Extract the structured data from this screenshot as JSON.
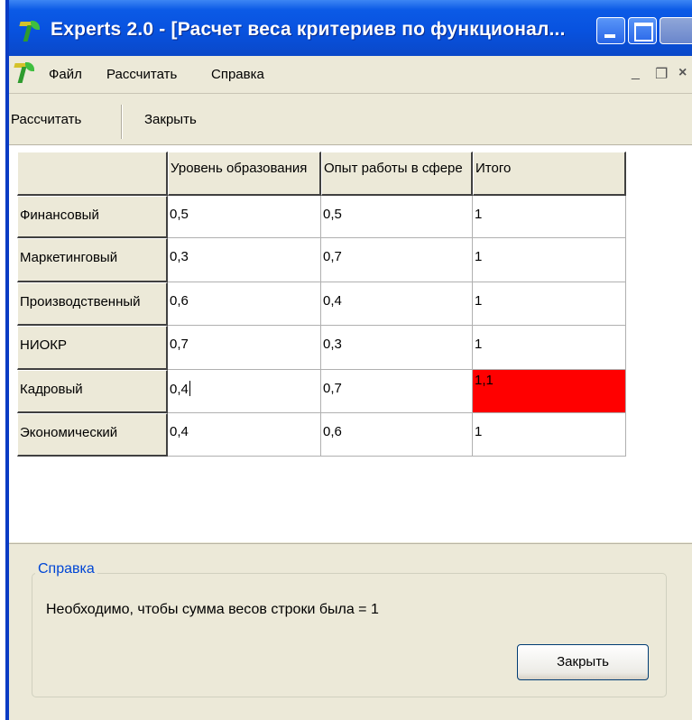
{
  "window": {
    "title": "Experts 2.0 - [Расчет веса критериев по функционал..."
  },
  "menu": {
    "items": [
      "Файл",
      "Рассчитать",
      "Справка"
    ],
    "mdi_min": "_",
    "mdi_restore": "❐",
    "mdi_close": "×"
  },
  "toolbar": {
    "calculate": "Рассчитать",
    "close": "Закрыть"
  },
  "grid": {
    "columns": [
      "",
      "Уровень образования",
      "Опыт работы в сфере",
      "Итого"
    ],
    "rows": [
      {
        "label": "Финансовый",
        "values": [
          "0,5",
          "0,5",
          "1"
        ],
        "invalid": false
      },
      {
        "label": "Маркетинговый",
        "values": [
          "0,3",
          "0,7",
          "1"
        ],
        "invalid": false
      },
      {
        "label": "Производственный",
        "values": [
          "0,6",
          "0,4",
          "1"
        ],
        "invalid": false
      },
      {
        "label": "НИОКР",
        "values": [
          "0,7",
          "0,3",
          "1"
        ],
        "invalid": false
      },
      {
        "label": "Кадровый",
        "values": [
          "0,4",
          "0,7",
          "1,1"
        ],
        "invalid": true
      },
      {
        "label": "Экономический",
        "values": [
          "0,4",
          "0,6",
          "1"
        ],
        "invalid": false
      }
    ],
    "error_color": "#ff0000"
  },
  "help": {
    "title": "Справка",
    "text": "Необходимо, чтобы сумма весов строки была = 1",
    "close_button": "Закрыть"
  },
  "colors": {
    "titlebar": "#0852df",
    "face": "#ece9d8",
    "legend": "#0046d5"
  }
}
